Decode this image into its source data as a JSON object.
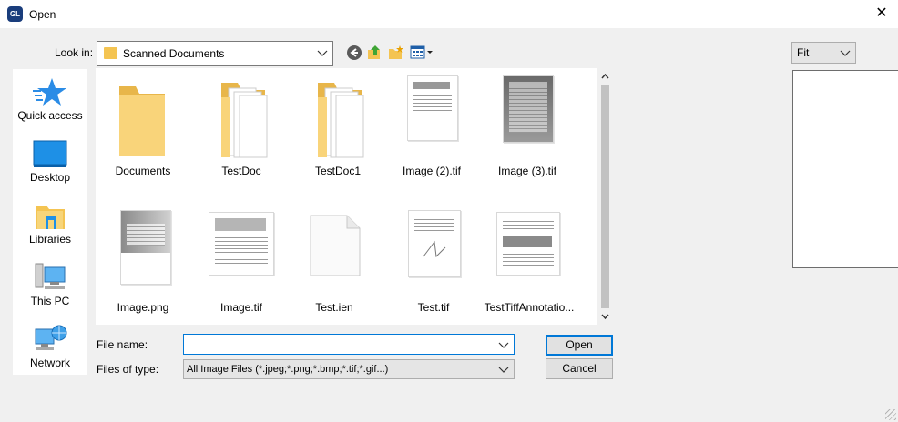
{
  "window": {
    "title": "Open",
    "app_icon_text": "GL",
    "close_glyph": "✕"
  },
  "lookin": {
    "label": "Look in:",
    "value": "Scanned Documents"
  },
  "toolbar": {
    "back_icon": "back-arrow-icon",
    "up_icon": "up-folder-icon",
    "new_icon": "new-folder-icon",
    "view_icon": "view-menu-icon"
  },
  "places": [
    {
      "label": "Quick access",
      "icon": "star-icon"
    },
    {
      "label": "Desktop",
      "icon": "desktop-icon"
    },
    {
      "label": "Libraries",
      "icon": "libraries-icon"
    },
    {
      "label": "This PC",
      "icon": "computer-icon"
    },
    {
      "label": "Network",
      "icon": "network-icon"
    }
  ],
  "files": [
    {
      "name": "Documents",
      "kind": "folder-empty"
    },
    {
      "name": "TestDoc",
      "kind": "folder-docs"
    },
    {
      "name": "TestDoc1",
      "kind": "folder-docs"
    },
    {
      "name": "Image (2).tif",
      "kind": "scan"
    },
    {
      "name": "Image (3).tif",
      "kind": "scan-dark"
    },
    {
      "name": "Image.png",
      "kind": "scan-gray"
    },
    {
      "name": "Image.tif",
      "kind": "scan"
    },
    {
      "name": "Test.ien",
      "kind": "blank"
    },
    {
      "name": "Test.tif",
      "kind": "scan"
    },
    {
      "name": "TestTiffAnnotatio...",
      "kind": "scan"
    }
  ],
  "filename": {
    "label": "File name:",
    "value": ""
  },
  "filetype": {
    "label": "Files of type:",
    "value": "All Image Files (*.jpeg;*.png;*.bmp;*.tif;*.gif...)"
  },
  "buttons": {
    "open": "Open",
    "cancel": "Cancel"
  },
  "zoom": {
    "value": "Fit"
  },
  "colors": {
    "accent": "#0078d7",
    "folder": "#f4c452"
  }
}
